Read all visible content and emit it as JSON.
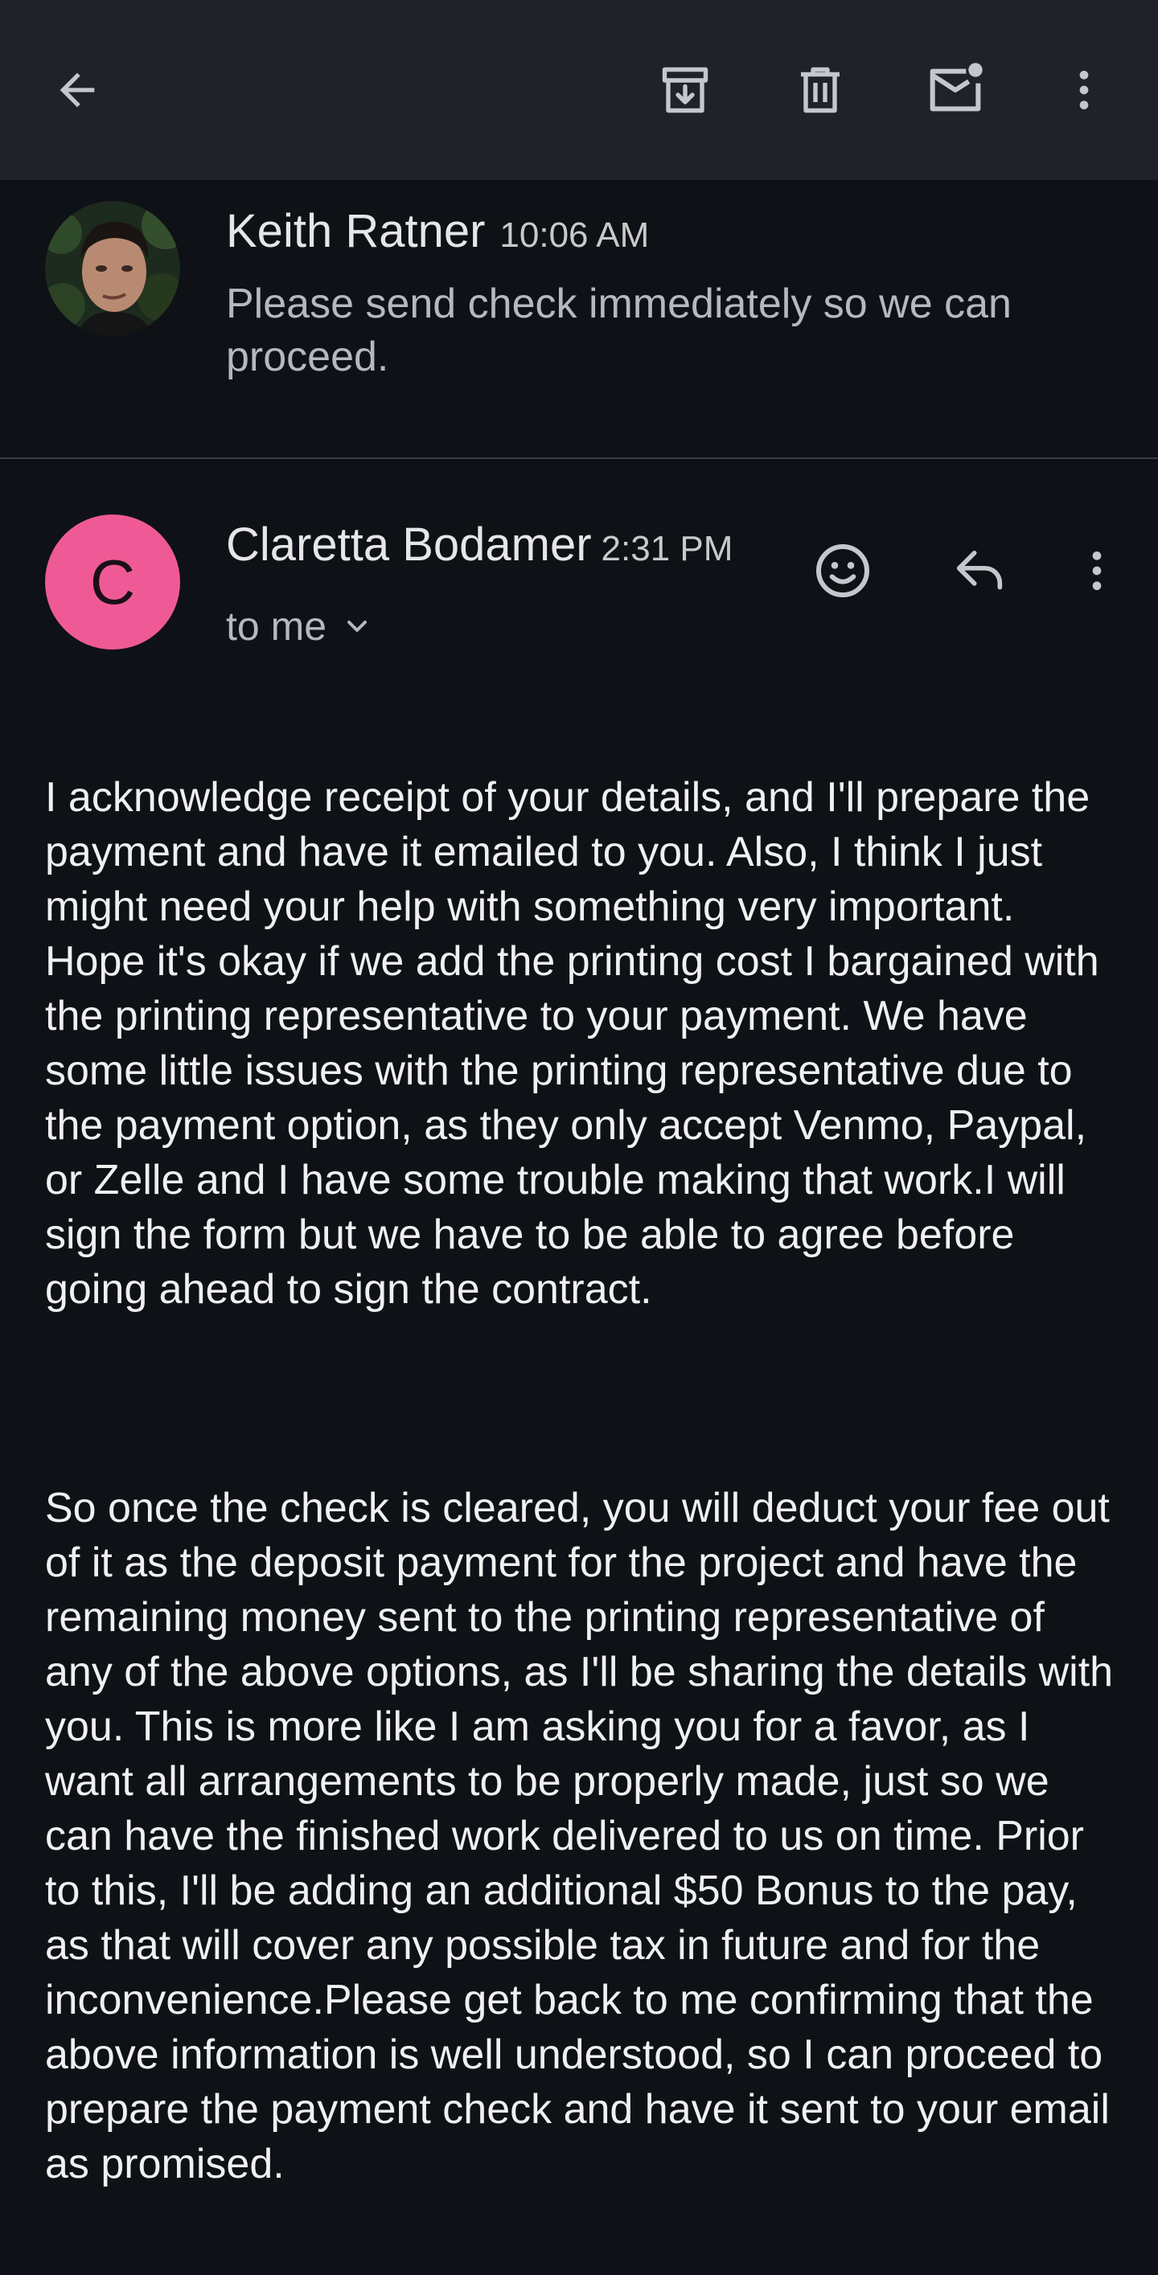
{
  "toolbar": {
    "back_icon": "arrow-back-icon",
    "archive_icon": "archive-icon",
    "delete_icon": "trash-icon",
    "mark_unread_icon": "mail-unread-icon",
    "more_icon": "more-vert-icon"
  },
  "previous_message": {
    "sender": "Keith Ratner",
    "time": "10:06 AM",
    "snippet": "Please send check immediately so we can proceed."
  },
  "current_message": {
    "avatar_letter": "C",
    "avatar_color": "#ef5a96",
    "sender": "Claretta Bodamer",
    "time": "2:31 PM",
    "recipient": "to me",
    "icons": [
      "emoji-react-icon",
      "reply-icon",
      "more-vert-icon"
    ],
    "paragraphs": [
      "I acknowledge receipt of your details, and I'll prepare the payment and have it emailed to you. Also, I think I  just might need your help with something very important. Hope it's okay if we add the printing cost I bargained with the printing representative to your payment. We have some little issues with the printing representative due to the payment option, as they only accept Venmo, Paypal, or Zelle and I have some trouble making that work.I will sign the form but we have to be able to agree before going ahead to sign the contract.",
      "So once the check is cleared, you will deduct your fee out of it as the deposit payment for the project and have the remaining money sent to the printing representative of any of the above options, as I'll be sharing the details with you. This is more like I am asking you for a favor, as I want all arrangements to be properly made, just so we can have the finished work delivered to us on time. Prior to this, I'll be adding an additional $50 Bonus to the pay, as that will cover any possible tax in future and for the inconvenience.Please get back to me confirming that the above information is well understood, so I can proceed to prepare the payment check and have it sent to your email as promised."
    ]
  }
}
